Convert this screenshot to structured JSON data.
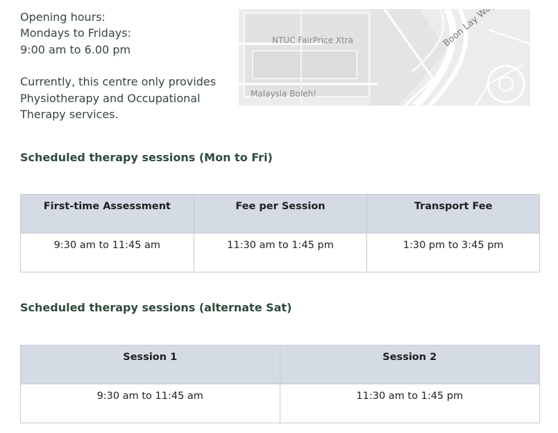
{
  "opening": {
    "label": "Opening hours:",
    "days": "Mondays to Fridays:",
    "hours": "9:00 am to 6.00 pm",
    "services_line1": "Currently, this centre only provides",
    "services_line2": "Physiotherapy and Occupational",
    "services_line3": "Therapy services."
  },
  "map": {
    "labels": {
      "fairprice": "NTUC FairPrice Xtra",
      "boleh": "Malaysia Boleh!",
      "road": "Boon Lay Way"
    }
  },
  "weekday_sessions": {
    "title": "Scheduled therapy sessions (Mon to Fri)",
    "headers": [
      "First-time Assessment",
      "Fee per Session",
      "Transport Fee"
    ],
    "row": [
      "9:30 am to 11:45 am",
      "11:30 am to 1:45 pm",
      "1:30 pm to 3:45 pm"
    ]
  },
  "saturday_sessions": {
    "title": "Scheduled therapy sessions (alternate Sat)",
    "headers": [
      "Session 1",
      "Session 2"
    ],
    "row": [
      "9:30 am to 11:45 am",
      "11:30 am to 1:45 pm"
    ]
  }
}
